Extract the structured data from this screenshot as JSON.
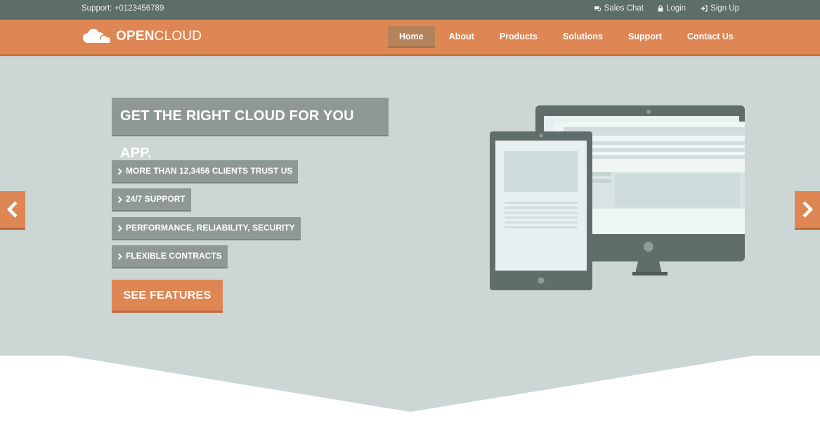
{
  "topbar": {
    "support_text": "Support: +0123456789",
    "links": [
      {
        "label": "Sales Chat",
        "icon": "chat-icon"
      },
      {
        "label": "Login",
        "icon": "lock-icon"
      },
      {
        "label": "Sign Up",
        "icon": "sign-in-icon"
      }
    ]
  },
  "brand": {
    "logo_bold": "OPEN",
    "logo_light": "CLOUD",
    "icon": "cloud-icon"
  },
  "nav": {
    "items": [
      {
        "label": "Home",
        "active": true
      },
      {
        "label": "About",
        "active": false
      },
      {
        "label": "Products",
        "active": false
      },
      {
        "label": "Solutions",
        "active": false
      },
      {
        "label": "Support",
        "active": false
      },
      {
        "label": "Contact Us",
        "active": false
      }
    ]
  },
  "hero": {
    "headline": "GET THE RIGHT CLOUD FOR YOU APP.",
    "features": [
      "MORE THAN 12,3456 CLIENTS TRUST US",
      "24/7 SUPPORT",
      "PERFORMANCE, RELIABILITY, SECURITY",
      "FLEXIBLE CONTRACTS"
    ],
    "cta_label": "SEE FEATURES",
    "prev_icon": "chevron-left-icon",
    "next_icon": "chevron-right-icon",
    "illustration": "devices-illustration"
  },
  "colors": {
    "topbar": "#5d6d6a",
    "accent": "#de8654",
    "hero_bg": "#cbd6d5",
    "label_bg": "#8e9896",
    "device": "#5f6d6b"
  }
}
